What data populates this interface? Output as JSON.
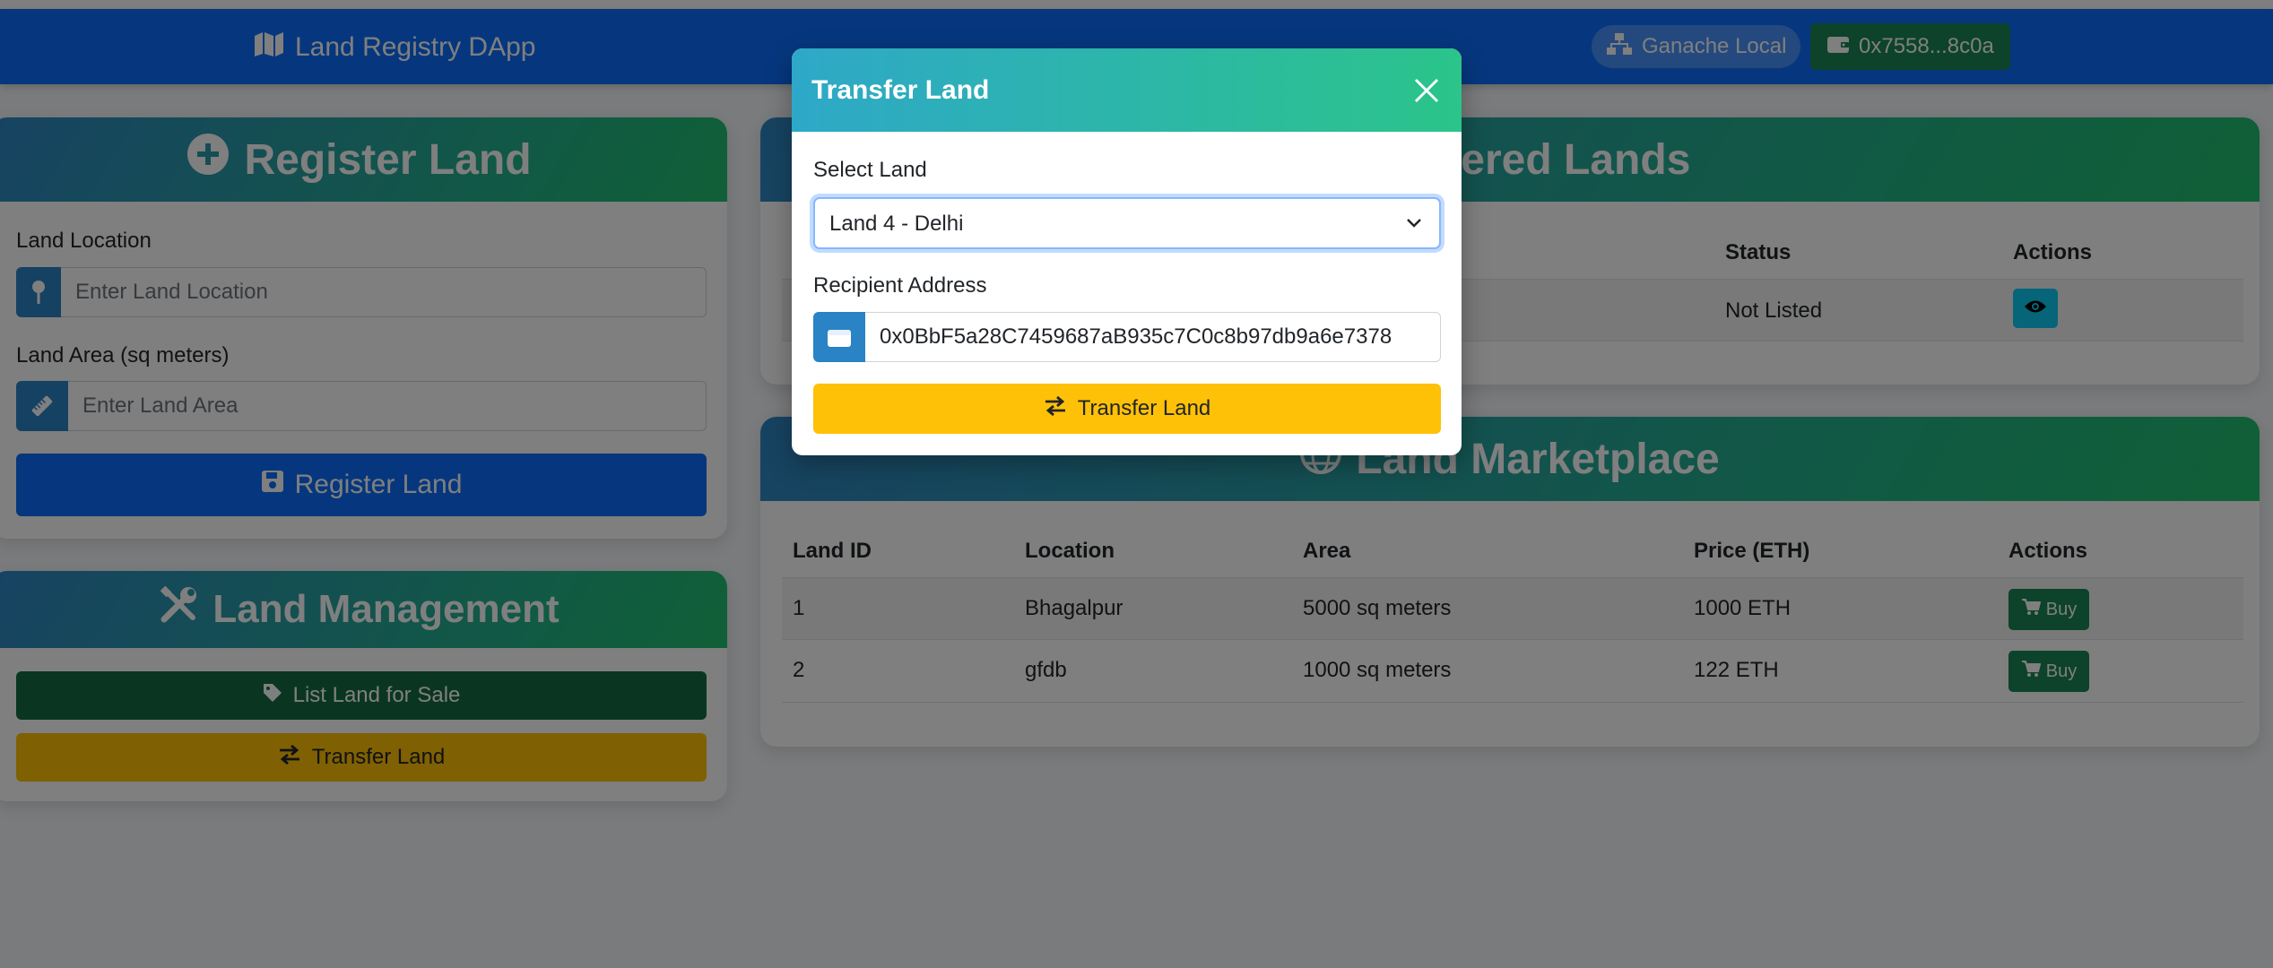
{
  "navbar": {
    "brand": "Land Registry DApp",
    "network": "Ganache Local",
    "account": "0x7558...8c0a"
  },
  "register": {
    "title": "Register Land",
    "location_label": "Land Location",
    "location_placeholder": "Enter Land Location",
    "area_label": "Land Area (sq meters)",
    "area_placeholder": "Enter Land Area",
    "submit_label": "Register Land"
  },
  "management": {
    "title": "Land Management",
    "list_label": "List Land for Sale",
    "transfer_label": "Transfer Land"
  },
  "registered": {
    "title": "Registered Lands",
    "headers": [
      "Status",
      "Actions"
    ],
    "rows": [
      {
        "status": "Not Listed"
      }
    ]
  },
  "marketplace": {
    "title": "Land Marketplace",
    "headers": [
      "Land ID",
      "Location",
      "Area",
      "Price (ETH)",
      "Actions"
    ],
    "rows": [
      {
        "id": "1",
        "location": "Bhagalpur",
        "area": "5000 sq meters",
        "price": "1000 ETH",
        "action": "Buy"
      },
      {
        "id": "2",
        "location": "gfdb",
        "area": "1000 sq meters",
        "price": "122 ETH",
        "action": "Buy"
      }
    ]
  },
  "modal": {
    "title": "Transfer Land",
    "select_label": "Select Land",
    "selected_land": "Land 4 - Delhi",
    "recipient_label": "Recipient Address",
    "recipient_value": "0x0BbF5a28C7459687aB935c7C0c8b97db9a6e7378",
    "submit_label": "Transfer Land"
  },
  "colors": {
    "primary": "#0d6efd",
    "success": "#198754",
    "warning": "#ffc107",
    "info": "#0dcaf0",
    "gradient_start": "#2f86c6",
    "gradient_end": "#20c06e"
  },
  "icons": {
    "brand": "map-icon",
    "network": "network-icon",
    "account": "wallet-icon",
    "register_title": "plus-circle-icon",
    "location": "map-pin-icon",
    "area": "ruler-icon",
    "save": "save-icon",
    "management": "tools-icon",
    "tag": "tag-icon",
    "transfer": "exchange-icon",
    "view": "eye-icon",
    "marketplace": "globe-icon",
    "cart": "cart-icon",
    "close": "close-icon",
    "dropdown": "chevron-down-icon"
  }
}
